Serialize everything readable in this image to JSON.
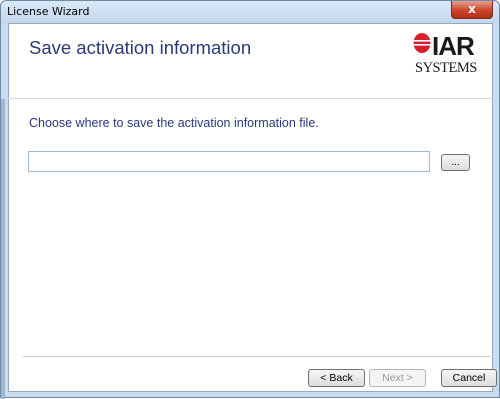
{
  "window": {
    "title": "License Wizard",
    "close_label": "x"
  },
  "header": {
    "title": "Save activation information",
    "logo": {
      "line1": "IAR",
      "line2": "SYSTEMS",
      "mark_color": "#d6202f"
    }
  },
  "main": {
    "instruction": "Choose where to save the activation information file.",
    "path_input": {
      "value": "",
      "placeholder": ""
    },
    "browse_label": "..."
  },
  "footer": {
    "back_label": "< Back",
    "next_label": "Next >",
    "cancel_label": "Cancel"
  },
  "colors": {
    "heading": "#2b3a78",
    "logo_red": "#d6202f"
  }
}
